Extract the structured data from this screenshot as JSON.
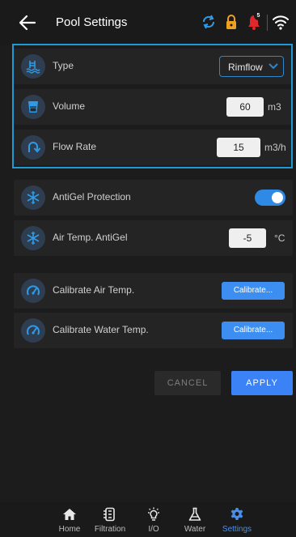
{
  "header": {
    "title": "Pool Settings",
    "notification_count": "5"
  },
  "pool": {
    "type": {
      "label": "Type",
      "value": "Rimflow"
    },
    "volume": {
      "label": "Volume",
      "value": "60",
      "unit": "m3"
    },
    "flow_rate": {
      "label": "Flow Rate",
      "value": "15",
      "unit": "m3/h"
    }
  },
  "antigel": {
    "protection_label": "AntiGel Protection",
    "protection_on": true,
    "air_temp_label": "Air Temp. AntiGel",
    "air_temp_value": "-5",
    "air_temp_unit": "°C"
  },
  "calibration": {
    "air_label": "Calibrate Air Temp.",
    "air_button": "Calibrate...",
    "water_label": "Calibrate Water Temp.",
    "water_button": "Calibrate..."
  },
  "actions": {
    "cancel": "CANCEL",
    "apply": "APPLY"
  },
  "nav": {
    "home": "Home",
    "filtration": "Filtration",
    "io": "I/O",
    "water": "Water",
    "settings": "Settings",
    "active": "settings"
  },
  "colors": {
    "accent": "#3b82f6",
    "highlight_border": "#1e9bd6",
    "sync_icon": "#2f9be6",
    "lock_icon": "#f0a020",
    "bell_icon": "#e0282c",
    "icon_circle": "#2e3d4f"
  }
}
